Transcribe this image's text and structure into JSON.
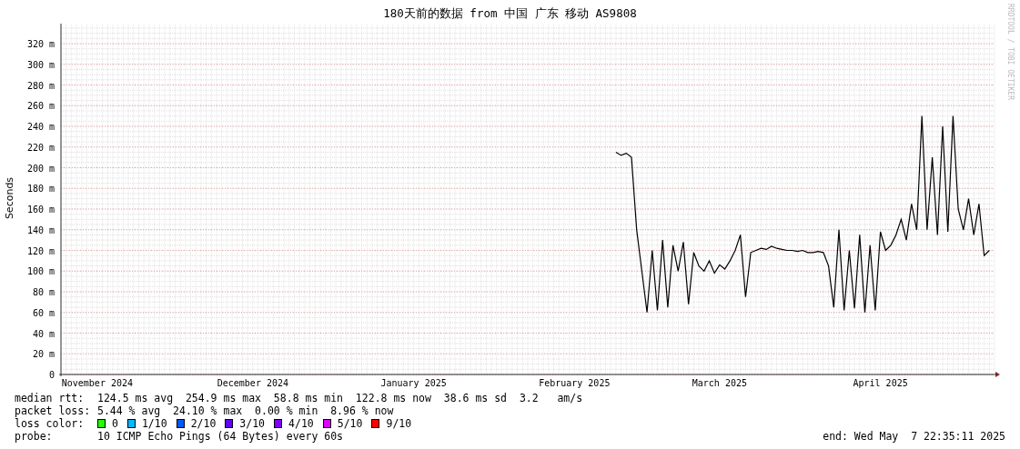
{
  "title": "180天前的数据 from 中国 广东 移动 AS9808",
  "credit": "RRDTOOL / TOBI OETIKER",
  "chart_data": {
    "type": "line",
    "ylabel": "Seconds",
    "ylim": [
      0,
      340
    ],
    "grid": true,
    "categories": [
      null,
      null,
      null,
      null,
      null,
      null,
      null,
      "November 2024",
      null,
      null,
      null,
      null,
      null,
      null,
      null,
      null,
      null,
      null,
      null,
      null,
      null,
      null,
      null,
      null,
      null,
      null,
      null,
      null,
      null,
      null,
      null,
      null,
      null,
      null,
      null,
      null,
      null,
      "December 2024",
      null,
      null,
      null,
      null,
      null,
      null,
      null,
      null,
      null,
      null,
      null,
      null,
      null,
      null,
      null,
      null,
      null,
      null,
      null,
      null,
      null,
      null,
      null,
      null,
      null,
      null,
      null,
      null,
      null,
      null,
      "January 2025",
      null,
      null,
      null,
      null,
      null,
      null,
      null,
      null,
      null,
      null,
      null,
      null,
      null,
      null,
      null,
      null,
      null,
      null,
      null,
      null,
      null,
      null,
      null,
      null,
      null,
      null,
      null,
      null,
      null,
      null,
      "February 2025",
      null,
      null,
      null,
      null,
      null,
      null,
      null,
      null,
      null,
      null,
      null,
      null,
      null,
      null,
      null,
      null,
      null,
      null,
      null,
      null,
      null,
      null,
      null,
      null,
      null,
      null,
      null,
      "March 2025",
      null,
      null,
      null,
      null,
      null,
      null,
      null,
      null,
      null,
      null,
      null,
      null,
      null,
      null,
      null,
      null,
      null,
      null,
      null,
      null,
      null,
      null,
      null,
      null,
      null,
      null,
      null,
      null,
      null,
      null,
      "April 2025",
      null,
      null,
      null,
      null,
      null,
      null,
      null,
      null,
      null,
      null,
      null,
      null,
      null,
      null,
      null,
      null,
      null,
      null,
      null,
      null,
      null
    ],
    "yticks": [
      {
        "value": 0,
        "label": "0"
      },
      {
        "value": 20,
        "label": "20 m"
      },
      {
        "value": 40,
        "label": "40 m"
      },
      {
        "value": 60,
        "label": "60 m"
      },
      {
        "value": 80,
        "label": "80 m"
      },
      {
        "value": 100,
        "label": "100 m"
      },
      {
        "value": 120,
        "label": "120 m"
      },
      {
        "value": 140,
        "label": "140 m"
      },
      {
        "value": 160,
        "label": "160 m"
      },
      {
        "value": 180,
        "label": "180 m"
      },
      {
        "value": 200,
        "label": "200 m"
      },
      {
        "value": 220,
        "label": "220 m"
      },
      {
        "value": 240,
        "label": "240 m"
      },
      {
        "value": 260,
        "label": "260 m"
      },
      {
        "value": 280,
        "label": "280 m"
      },
      {
        "value": 300,
        "label": "300 m"
      },
      {
        "value": 320,
        "label": "320 m"
      }
    ],
    "series": [
      {
        "name": "median rtt:",
        "color": "#000000",
        "values": [
          null,
          null,
          null,
          null,
          null,
          null,
          null,
          null,
          null,
          null,
          null,
          null,
          null,
          null,
          null,
          null,
          null,
          null,
          null,
          null,
          null,
          null,
          null,
          null,
          null,
          null,
          null,
          null,
          null,
          null,
          null,
          null,
          null,
          null,
          null,
          null,
          null,
          null,
          null,
          null,
          null,
          null,
          null,
          null,
          null,
          null,
          null,
          null,
          null,
          null,
          null,
          null,
          null,
          null,
          null,
          null,
          null,
          null,
          null,
          null,
          null,
          null,
          null,
          null,
          null,
          null,
          null,
          null,
          null,
          null,
          null,
          null,
          null,
          null,
          null,
          null,
          null,
          null,
          null,
          null,
          null,
          null,
          null,
          null,
          null,
          null,
          null,
          null,
          null,
          null,
          null,
          null,
          null,
          null,
          null,
          null,
          null,
          null,
          null,
          null,
          null,
          null,
          null,
          null,
          null,
          null,
          null,
          215,
          212,
          214,
          210,
          140,
          100,
          60,
          120,
          62,
          130,
          65,
          125,
          100,
          128,
          68,
          118,
          105,
          100,
          110,
          98,
          106,
          102,
          110,
          120,
          135,
          75,
          118,
          120,
          122,
          121,
          124,
          122,
          121,
          120,
          120,
          119,
          120,
          118,
          118,
          119,
          118,
          105,
          65,
          140,
          62,
          120,
          64,
          135,
          60,
          125,
          62,
          138,
          120,
          125,
          135,
          150,
          130,
          165,
          140,
          250,
          140,
          210,
          135,
          240,
          138,
          250,
          160,
          140,
          170,
          135,
          165,
          115,
          120
        ]
      }
    ]
  },
  "stats": [
    {
      "text": "124.5 ms avg  254.9 ms max  58.8 ms min  122.8 ms now  38.6 ms sd  3.2   am/s"
    },
    {
      "label": "packet loss:",
      "text": "5.44 % avg  24.10 % max  0.00 % min  8.96 % now"
    }
  ],
  "loss_color": {
    "label": "loss color:",
    "items": [
      {
        "label": "0",
        "color": "#26ff00"
      },
      {
        "label": "1/10",
        "color": "#00b8ff"
      },
      {
        "label": "2/10",
        "color": "#0059ff"
      },
      {
        "label": "3/10",
        "color": "#5e00ff"
      },
      {
        "label": "4/10",
        "color": "#7e00ff"
      },
      {
        "label": "5/10",
        "color": "#dd00ff"
      },
      {
        "label": "9/10",
        "color": "#ff0000"
      }
    ]
  },
  "probe": {
    "label": "probe:",
    "text": "10 ICMP Echo Pings (64 Bytes) every 60s"
  },
  "end": "end: Wed May  7 22:35:11 2025"
}
